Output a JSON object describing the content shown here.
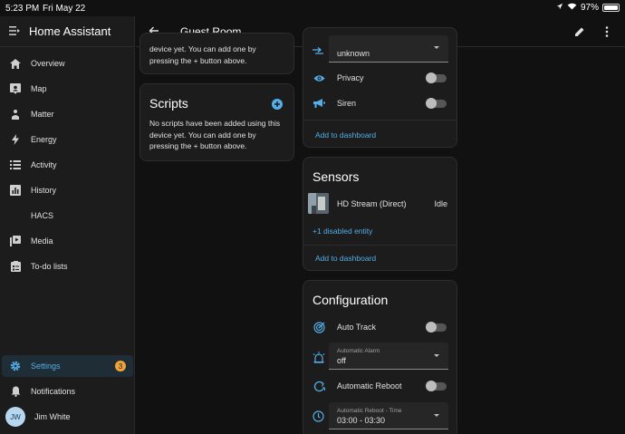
{
  "status_bar": {
    "time": "5:23 PM",
    "date": "Fri May 22",
    "battery": "97%",
    "battery_level": 0.97
  },
  "sidebar": {
    "title": "Home Assistant",
    "items": [
      {
        "label": "Overview",
        "icon": "home-icon"
      },
      {
        "label": "Map",
        "icon": "map-icon"
      },
      {
        "label": "Matter",
        "icon": "matter-icon"
      },
      {
        "label": "Energy",
        "icon": "lightning-icon"
      },
      {
        "label": "Activity",
        "icon": "list-icon"
      },
      {
        "label": "History",
        "icon": "chart-icon"
      },
      {
        "label": "HACS",
        "icon": ""
      },
      {
        "label": "Media",
        "icon": "media-icon"
      },
      {
        "label": "To-do lists",
        "icon": "clipboard-icon"
      }
    ],
    "settings": {
      "label": "Settings",
      "badge": "3"
    },
    "notifications": {
      "label": "Notifications"
    },
    "user": {
      "initials": "JW",
      "name": "Jim White"
    }
  },
  "topbar": {
    "title": "Guest Room"
  },
  "left_column": {
    "top_card_text": "device yet. You can add one by pressing the + button above.",
    "scripts": {
      "title": "Scripts",
      "text": "No scripts have been added using this device yet. You can add one by pressing the + button above."
    }
  },
  "controls_card": {
    "select_value": "unknown",
    "privacy_label": "Privacy",
    "siren_label": "Siren",
    "add_to_dashboard": "Add to dashboard"
  },
  "sensors_card": {
    "title": "Sensors",
    "stream_name": "HD Stream (Direct)",
    "stream_state": "Idle",
    "disabled_entities": "+1 disabled entity",
    "add_to_dashboard": "Add to dashboard"
  },
  "configuration_card": {
    "title": "Configuration",
    "auto_track": "Auto Track",
    "automatic_alarm": {
      "label": "Automatic Alarm",
      "value": "off"
    },
    "automatic_reboot": "Automatic Reboot",
    "reboot_time": {
      "label": "Automatic Reboot - Time",
      "value": "03:00 - 03:30"
    }
  },
  "colors": {
    "accent": "#54aee8",
    "badge": "#f2a43a",
    "card": "#1c1c1c",
    "background": "#111111"
  }
}
